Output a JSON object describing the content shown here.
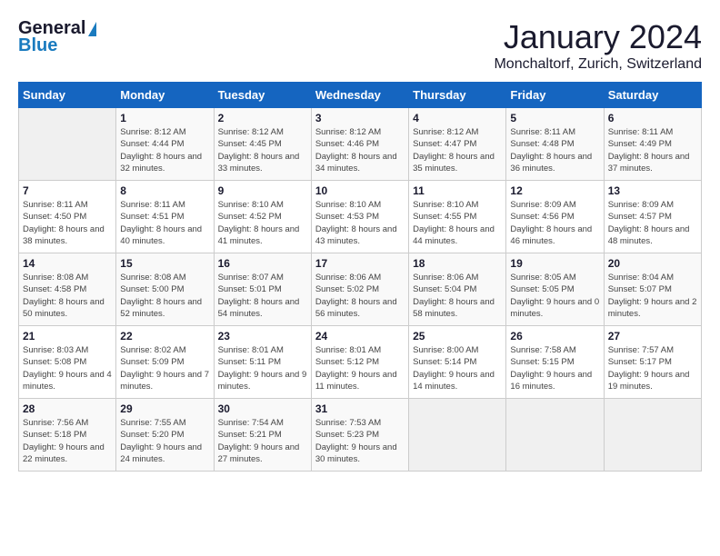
{
  "logo": {
    "general": "General",
    "blue": "Blue"
  },
  "title": "January 2024",
  "subtitle": "Monchaltorf, Zurich, Switzerland",
  "days_of_week": [
    "Sunday",
    "Monday",
    "Tuesday",
    "Wednesday",
    "Thursday",
    "Friday",
    "Saturday"
  ],
  "weeks": [
    [
      {
        "day": "",
        "sunrise": "",
        "sunset": "",
        "daylight": ""
      },
      {
        "day": "1",
        "sunrise": "Sunrise: 8:12 AM",
        "sunset": "Sunset: 4:44 PM",
        "daylight": "Daylight: 8 hours and 32 minutes."
      },
      {
        "day": "2",
        "sunrise": "Sunrise: 8:12 AM",
        "sunset": "Sunset: 4:45 PM",
        "daylight": "Daylight: 8 hours and 33 minutes."
      },
      {
        "day": "3",
        "sunrise": "Sunrise: 8:12 AM",
        "sunset": "Sunset: 4:46 PM",
        "daylight": "Daylight: 8 hours and 34 minutes."
      },
      {
        "day": "4",
        "sunrise": "Sunrise: 8:12 AM",
        "sunset": "Sunset: 4:47 PM",
        "daylight": "Daylight: 8 hours and 35 minutes."
      },
      {
        "day": "5",
        "sunrise": "Sunrise: 8:11 AM",
        "sunset": "Sunset: 4:48 PM",
        "daylight": "Daylight: 8 hours and 36 minutes."
      },
      {
        "day": "6",
        "sunrise": "Sunrise: 8:11 AM",
        "sunset": "Sunset: 4:49 PM",
        "daylight": "Daylight: 8 hours and 37 minutes."
      }
    ],
    [
      {
        "day": "7",
        "sunrise": "Sunrise: 8:11 AM",
        "sunset": "Sunset: 4:50 PM",
        "daylight": "Daylight: 8 hours and 38 minutes."
      },
      {
        "day": "8",
        "sunrise": "Sunrise: 8:11 AM",
        "sunset": "Sunset: 4:51 PM",
        "daylight": "Daylight: 8 hours and 40 minutes."
      },
      {
        "day": "9",
        "sunrise": "Sunrise: 8:10 AM",
        "sunset": "Sunset: 4:52 PM",
        "daylight": "Daylight: 8 hours and 41 minutes."
      },
      {
        "day": "10",
        "sunrise": "Sunrise: 8:10 AM",
        "sunset": "Sunset: 4:53 PM",
        "daylight": "Daylight: 8 hours and 43 minutes."
      },
      {
        "day": "11",
        "sunrise": "Sunrise: 8:10 AM",
        "sunset": "Sunset: 4:55 PM",
        "daylight": "Daylight: 8 hours and 44 minutes."
      },
      {
        "day": "12",
        "sunrise": "Sunrise: 8:09 AM",
        "sunset": "Sunset: 4:56 PM",
        "daylight": "Daylight: 8 hours and 46 minutes."
      },
      {
        "day": "13",
        "sunrise": "Sunrise: 8:09 AM",
        "sunset": "Sunset: 4:57 PM",
        "daylight": "Daylight: 8 hours and 48 minutes."
      }
    ],
    [
      {
        "day": "14",
        "sunrise": "Sunrise: 8:08 AM",
        "sunset": "Sunset: 4:58 PM",
        "daylight": "Daylight: 8 hours and 50 minutes."
      },
      {
        "day": "15",
        "sunrise": "Sunrise: 8:08 AM",
        "sunset": "Sunset: 5:00 PM",
        "daylight": "Daylight: 8 hours and 52 minutes."
      },
      {
        "day": "16",
        "sunrise": "Sunrise: 8:07 AM",
        "sunset": "Sunset: 5:01 PM",
        "daylight": "Daylight: 8 hours and 54 minutes."
      },
      {
        "day": "17",
        "sunrise": "Sunrise: 8:06 AM",
        "sunset": "Sunset: 5:02 PM",
        "daylight": "Daylight: 8 hours and 56 minutes."
      },
      {
        "day": "18",
        "sunrise": "Sunrise: 8:06 AM",
        "sunset": "Sunset: 5:04 PM",
        "daylight": "Daylight: 8 hours and 58 minutes."
      },
      {
        "day": "19",
        "sunrise": "Sunrise: 8:05 AM",
        "sunset": "Sunset: 5:05 PM",
        "daylight": "Daylight: 9 hours and 0 minutes."
      },
      {
        "day": "20",
        "sunrise": "Sunrise: 8:04 AM",
        "sunset": "Sunset: 5:07 PM",
        "daylight": "Daylight: 9 hours and 2 minutes."
      }
    ],
    [
      {
        "day": "21",
        "sunrise": "Sunrise: 8:03 AM",
        "sunset": "Sunset: 5:08 PM",
        "daylight": "Daylight: 9 hours and 4 minutes."
      },
      {
        "day": "22",
        "sunrise": "Sunrise: 8:02 AM",
        "sunset": "Sunset: 5:09 PM",
        "daylight": "Daylight: 9 hours and 7 minutes."
      },
      {
        "day": "23",
        "sunrise": "Sunrise: 8:01 AM",
        "sunset": "Sunset: 5:11 PM",
        "daylight": "Daylight: 9 hours and 9 minutes."
      },
      {
        "day": "24",
        "sunrise": "Sunrise: 8:01 AM",
        "sunset": "Sunset: 5:12 PM",
        "daylight": "Daylight: 9 hours and 11 minutes."
      },
      {
        "day": "25",
        "sunrise": "Sunrise: 8:00 AM",
        "sunset": "Sunset: 5:14 PM",
        "daylight": "Daylight: 9 hours and 14 minutes."
      },
      {
        "day": "26",
        "sunrise": "Sunrise: 7:58 AM",
        "sunset": "Sunset: 5:15 PM",
        "daylight": "Daylight: 9 hours and 16 minutes."
      },
      {
        "day": "27",
        "sunrise": "Sunrise: 7:57 AM",
        "sunset": "Sunset: 5:17 PM",
        "daylight": "Daylight: 9 hours and 19 minutes."
      }
    ],
    [
      {
        "day": "28",
        "sunrise": "Sunrise: 7:56 AM",
        "sunset": "Sunset: 5:18 PM",
        "daylight": "Daylight: 9 hours and 22 minutes."
      },
      {
        "day": "29",
        "sunrise": "Sunrise: 7:55 AM",
        "sunset": "Sunset: 5:20 PM",
        "daylight": "Daylight: 9 hours and 24 minutes."
      },
      {
        "day": "30",
        "sunrise": "Sunrise: 7:54 AM",
        "sunset": "Sunset: 5:21 PM",
        "daylight": "Daylight: 9 hours and 27 minutes."
      },
      {
        "day": "31",
        "sunrise": "Sunrise: 7:53 AM",
        "sunset": "Sunset: 5:23 PM",
        "daylight": "Daylight: 9 hours and 30 minutes."
      },
      {
        "day": "",
        "sunrise": "",
        "sunset": "",
        "daylight": ""
      },
      {
        "day": "",
        "sunrise": "",
        "sunset": "",
        "daylight": ""
      },
      {
        "day": "",
        "sunrise": "",
        "sunset": "",
        "daylight": ""
      }
    ]
  ]
}
